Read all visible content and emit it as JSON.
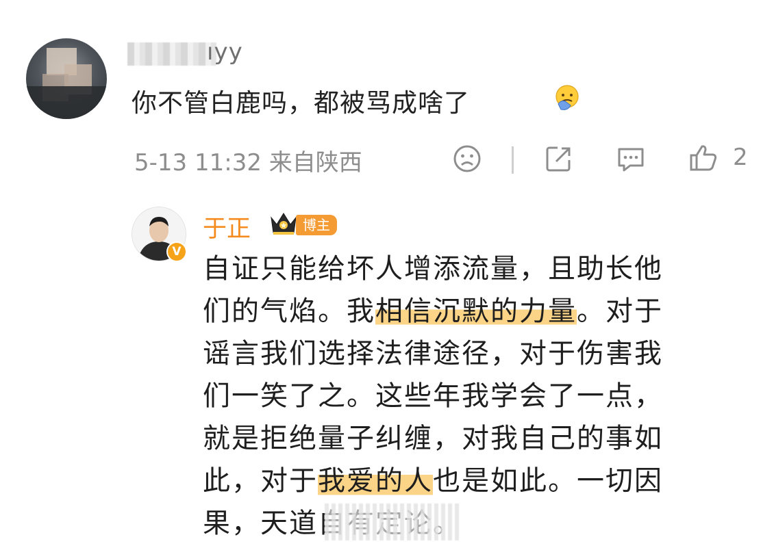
{
  "top_comment": {
    "username_visible": "ıyy",
    "text": "你不管白鹿吗，都被骂成啥了",
    "meta": "5-13 11:32 来自陕西",
    "like_count": "2",
    "icons": [
      "sad-face-icon",
      "share-icon",
      "comment-icon",
      "thumbs-up-icon"
    ],
    "emoji": "facepalm-emoji"
  },
  "reply": {
    "username": "于正",
    "badge": "博主",
    "verified": "V",
    "lines": [
      {
        "text": "自证只能给坏人增添流量，且助长他"
      },
      {
        "pre": "们的气焰。我",
        "highlight": "相信沉默的力量",
        "post": "。对于"
      },
      {
        "text": "谣言我们选择法律途径，对于伤害我"
      },
      {
        "text": "们一笑了之。这些年我学会了一点，"
      },
      {
        "text": "就是拒绝量子纠缠，对我自己的事如"
      },
      {
        "pre": "此，对于",
        "highlight": "我爱的人",
        "post": "也是如此。一切因"
      },
      {
        "text": "果，天道自有定论。"
      }
    ]
  },
  "colors": {
    "username_orange": "#f58a1f",
    "highlight": "#fbd487",
    "badge": "#f59b34",
    "meta_gray": "#8d8d8d"
  }
}
